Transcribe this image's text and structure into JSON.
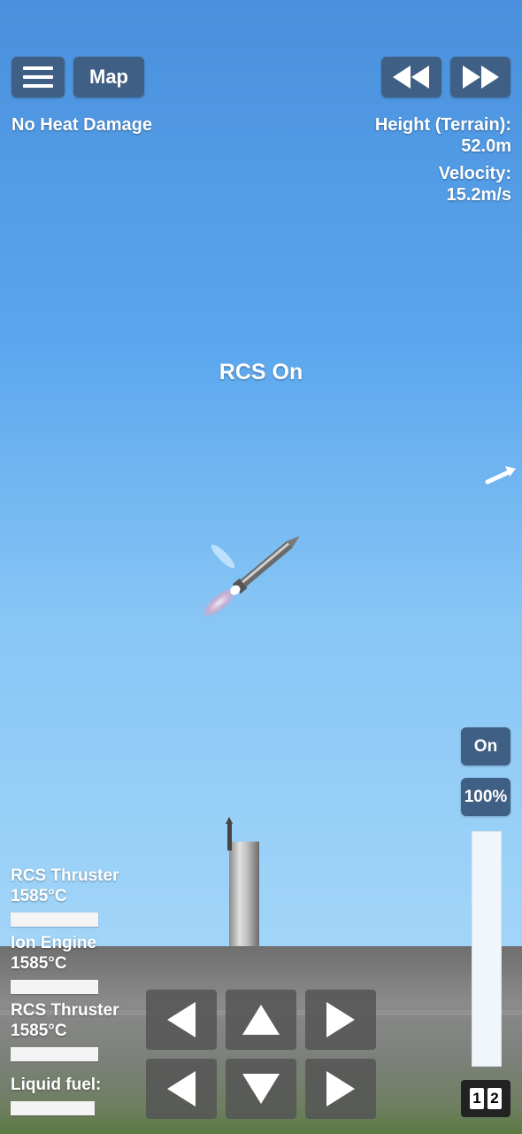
{
  "menu": {
    "icon": "hamburger-icon"
  },
  "map_label": "Map",
  "time": {
    "rewind_icon": "rewind-icon",
    "fastforward_icon": "fast-forward-icon"
  },
  "status": "No Heat Damage",
  "telemetry": {
    "height_label": "Height (Terrain):",
    "height_value": "52.0m",
    "velocity_label": "Velocity:",
    "velocity_value": "15.2m/s"
  },
  "notification": "RCS On",
  "parts": [
    {
      "name": "RCS Thruster",
      "temp": "1585°C"
    },
    {
      "name": "Ion Engine",
      "temp": "1585°C"
    },
    {
      "name": "RCS Thruster",
      "temp": "1585°C"
    },
    {
      "name": "Liquid fuel:",
      "temp": ""
    }
  ],
  "throttle": {
    "toggle_label": "On",
    "percent_label": "100%",
    "level": 1.0
  },
  "stage_labels": [
    "1",
    "2"
  ],
  "controls": {
    "row1": [
      "rotate-left-icon",
      "pitch-up-icon",
      "rotate-right-icon"
    ],
    "row2": [
      "translate-left-icon",
      "pitch-down-icon",
      "translate-right-icon"
    ]
  },
  "colors": {
    "button_bg": "#3f5f84",
    "sky_top": "#4a90dc",
    "sky_bottom": "#a5d8fa"
  }
}
